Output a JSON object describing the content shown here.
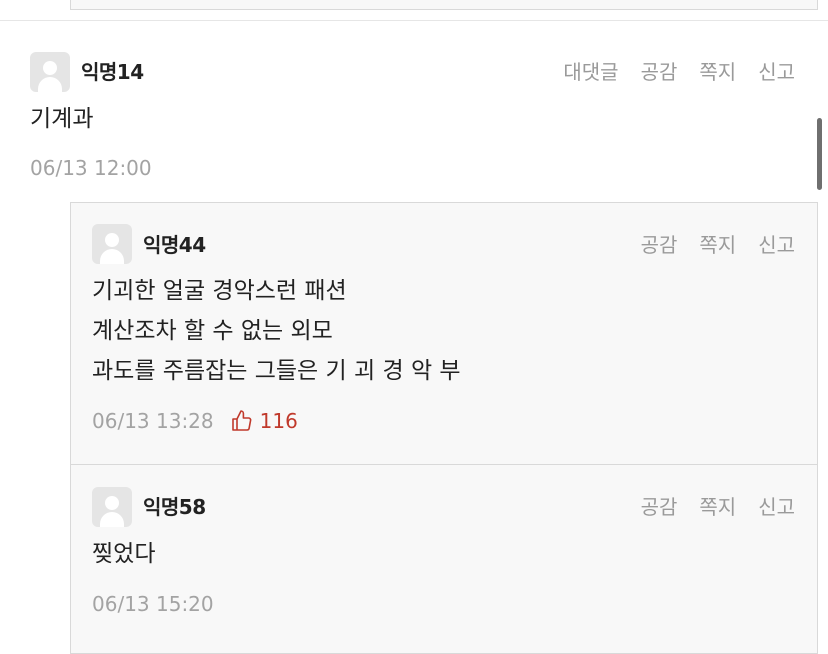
{
  "comment": {
    "nickname": "익명14",
    "actions": {
      "reply": "대댓글",
      "like": "공감",
      "message": "쪽지",
      "report": "신고"
    },
    "text": "기계과",
    "time": "06/13 12:00"
  },
  "replies": [
    {
      "nickname": "익명44",
      "actions": {
        "like": "공감",
        "message": "쪽지",
        "report": "신고"
      },
      "lines": [
        "기괴한 얼굴 경악스런 패션",
        "계산조차 할 수 없는 외모",
        "과도를 주름잡는 그들은 기 괴 경 악 부"
      ],
      "time": "06/13 13:28",
      "vote_count": "116"
    },
    {
      "nickname": "익명58",
      "actions": {
        "like": "공감",
        "message": "쪽지",
        "report": "신고"
      },
      "text": "찢었다",
      "time": "06/13 15:20"
    }
  ],
  "colors": {
    "accent_vote": "#c0392b",
    "muted": "#9a9a9a"
  },
  "icons": {
    "avatar": "default-avatar-icon",
    "vote": "thumbs-up-icon"
  }
}
